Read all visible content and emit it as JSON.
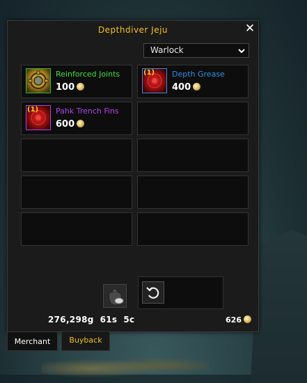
{
  "window": {
    "title": "Depthdiver Jeju"
  },
  "filter": {
    "selected": "Warlock"
  },
  "items": [
    {
      "name": "Reinforced Joints",
      "price": "100",
      "qty": "",
      "name_color": "#3ee03e",
      "icon": "diving-helmet-icon"
    },
    {
      "name": "Depth Grease",
      "price": "400",
      "qty": "(1)",
      "name_color": "#2f8fe8",
      "icon": "red-orb-icon"
    },
    {
      "name": "Pahk Trench Fins",
      "price": "600",
      "qty": "(1)",
      "name_color": "#b045e8",
      "icon": "red-orb-icon"
    }
  ],
  "currency": {
    "gold": "276,298g",
    "silver": "61s",
    "copper": "5c",
    "tokens": "626"
  },
  "tabs": {
    "merchant": "Merchant",
    "buyback": "Buyback"
  },
  "colors": {
    "title": "#f2c21a",
    "panel": "#1b1b1b",
    "slot": "#0d0d0d"
  }
}
